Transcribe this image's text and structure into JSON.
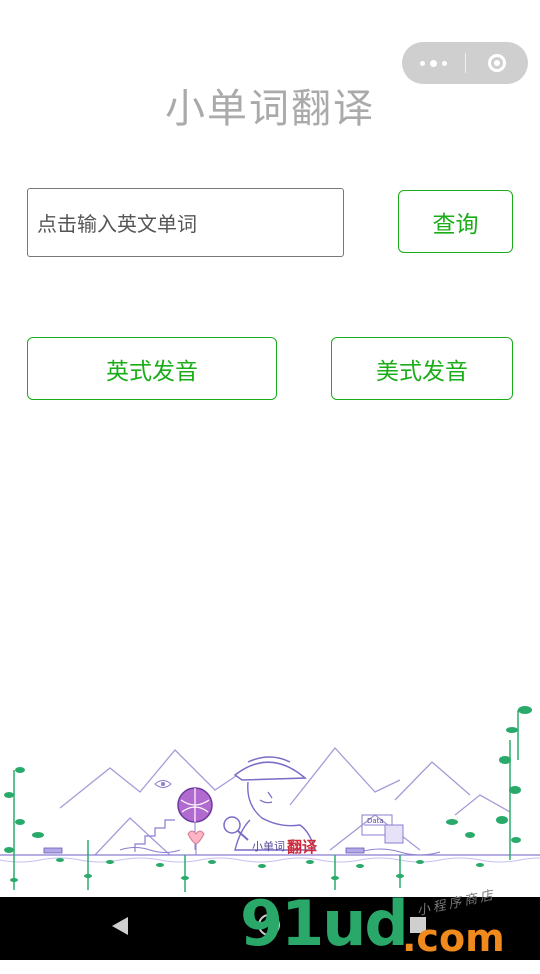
{
  "capsule": {
    "more_icon": "more-dots-icon",
    "close_icon": "close-circle-icon"
  },
  "page": {
    "title": "小单词翻译"
  },
  "search": {
    "placeholder": "点击输入英文单词",
    "query_label": "查询"
  },
  "pronounce": {
    "uk_label": "英式发音",
    "us_label": "美式发音"
  },
  "illustration": {
    "caption_small": "小单词",
    "caption_big": "翻译",
    "data_tag": "Data"
  },
  "watermark": {
    "main": "91ud",
    "suffix": ".com",
    "sub": "小程序商店"
  },
  "colors": {
    "accent": "#1aad19",
    "title": "#aaaaaa",
    "capsule": "#cfcfcf"
  }
}
